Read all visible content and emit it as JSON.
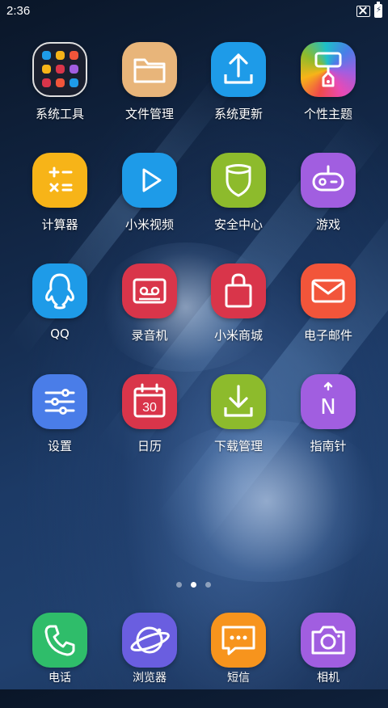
{
  "status_bar": {
    "time": "2:36",
    "icons": [
      "no-sim-icon",
      "battery-charging-icon"
    ]
  },
  "apps": [
    {
      "label": "系统工具",
      "icon": "folder-tools-icon",
      "color": "#1a1f2e"
    },
    {
      "label": "文件管理",
      "icon": "folder-icon",
      "color": "#e8b57a"
    },
    {
      "label": "系统更新",
      "icon": "upload-icon",
      "color": "#1e9be8"
    },
    {
      "label": "个性主题",
      "icon": "paint-roller-icon",
      "color": "rainbow"
    },
    {
      "label": "计算器",
      "icon": "calculator-icon",
      "color": "#f7b418"
    },
    {
      "label": "小米视频",
      "icon": "play-icon",
      "color": "#1e9be8"
    },
    {
      "label": "安全中心",
      "icon": "shield-icon",
      "color": "#8dbb2c"
    },
    {
      "label": "游戏",
      "icon": "gamepad-icon",
      "color": "#a15ee0"
    },
    {
      "label": "QQ",
      "icon": "penguin-icon",
      "color": "#1e9be8"
    },
    {
      "label": "录音机",
      "icon": "cassette-icon",
      "color": "#d9354a"
    },
    {
      "label": "小米商城",
      "icon": "shopping-bag-icon",
      "color": "#d9354a"
    },
    {
      "label": "电子邮件",
      "icon": "mail-icon",
      "color": "#f2553a"
    },
    {
      "label": "设置",
      "icon": "sliders-icon",
      "color": "#4a7de8"
    },
    {
      "label": "日历",
      "icon": "calendar-icon",
      "color": "#d9354a",
      "day": "30"
    },
    {
      "label": "下载管理",
      "icon": "download-icon",
      "color": "#8dbb2c"
    },
    {
      "label": "指南针",
      "icon": "compass-icon",
      "color": "#a15ee0",
      "letter": "N"
    }
  ],
  "pages": {
    "count": 3,
    "active": 2
  },
  "dock": [
    {
      "label": "电话",
      "icon": "phone-icon",
      "color": "#2fbd6a"
    },
    {
      "label": "浏览器",
      "icon": "globe-icon",
      "color": "#6a5ee0"
    },
    {
      "label": "短信",
      "icon": "chat-icon",
      "color": "#f7941d"
    },
    {
      "label": "相机",
      "icon": "camera-icon",
      "color": "#a15ee0"
    }
  ]
}
